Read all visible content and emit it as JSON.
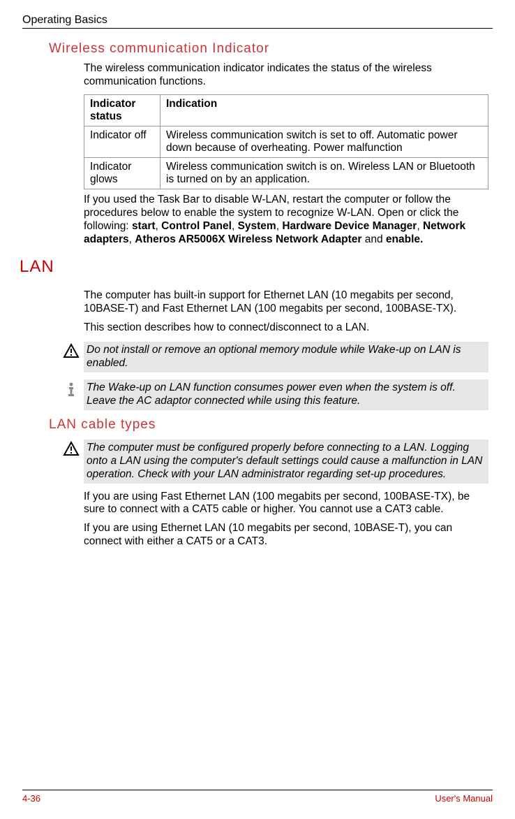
{
  "header": {
    "left": "Operating Basics"
  },
  "section1": {
    "heading": "Wireless communication Indicator",
    "intro": "The wireless communication indicator indicates the status of the wireless communication functions.",
    "table": {
      "headers": [
        "Indicator status",
        "Indication"
      ],
      "rows": [
        {
          "c0": "Indicator off",
          "c1": "Wireless communication switch is set to off. Automatic power down because of overheating. Power malfunction"
        },
        {
          "c0": "Indicator glows",
          "c1": "Wireless communication switch is on. Wireless LAN or Bluetooth is turned on by an application."
        }
      ]
    },
    "after": {
      "pre": "If you used the Task Bar to disable W-LAN, restart the computer or follow the procedures below to enable the system to recognize W-LAN. Open or click the following: ",
      "b0": "start",
      "s0": ", ",
      "b1": "Control Panel",
      "s1": ", ",
      "b2": "System",
      "s2": ", ",
      "b3": "Hardware Device Manager",
      "s3": ", ",
      "b4": "Network adapters",
      "s4": ", ",
      "b5": "Atheros AR5006X Wireless Network Adapter",
      "s5": " and ",
      "b6": "enable."
    }
  },
  "lan": {
    "heading": "LAN",
    "p1": "The computer has built-in support for Ethernet LAN (10 megabits per second, 10BASE-T) and Fast Ethernet LAN (100 megabits per second, 100BASE-TX).",
    "p2": "This section describes how to connect/disconnect to a LAN.",
    "note1": "Do not install or remove an optional memory module while Wake-up on LAN is enabled.",
    "note2": "The Wake-up on LAN function consumes power even when the system is off. Leave the AC adaptor connected while using this feature.",
    "sub": {
      "heading": "LAN cable types",
      "note": "The computer must be configured properly before connecting to a LAN. Logging onto a LAN using the computer's default settings could cause a malfunction in LAN operation. Check with your LAN administrator regarding set-up procedures.",
      "p1": "If you are using Fast Ethernet LAN (100 megabits per second, 100BASE-TX), be sure to connect with a CAT5 cable or higher. You cannot use a CAT3 cable.",
      "p2": "If you are using Ethernet LAN (10 megabits per second, 10BASE-T), you can connect with either a CAT5 or a CAT3."
    }
  },
  "footer": {
    "left": "4-36",
    "right": "User's Manual"
  }
}
